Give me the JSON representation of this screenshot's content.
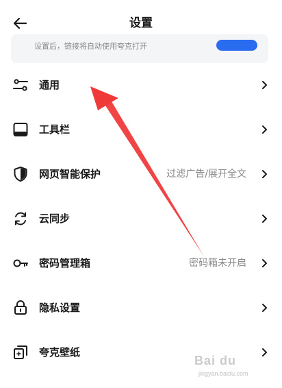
{
  "header": {
    "title": "设置"
  },
  "notice": {
    "text": "设置后，链接将自动使用夸克打开"
  },
  "settings": [
    {
      "label": "通用",
      "value": "",
      "icon": "sliders-icon"
    },
    {
      "label": "工具栏",
      "value": "",
      "icon": "toolbar-icon"
    },
    {
      "label": "网页智能保护",
      "value": "过滤广告/展开全文",
      "icon": "shield-icon"
    },
    {
      "label": "云同步",
      "value": "",
      "icon": "sync-icon"
    },
    {
      "label": "密码管理箱",
      "value": "密码箱未开启",
      "icon": "key-icon"
    },
    {
      "label": "隐私设置",
      "value": "",
      "icon": "lock-icon"
    },
    {
      "label": "夸克壁纸",
      "value": "",
      "icon": "wallpaper-icon"
    }
  ],
  "watermark": {
    "brand": "Bai du",
    "domain": "jingyan.baidu.com"
  },
  "colors": {
    "accent": "#2a6cf0",
    "annotation_arrow": "#f03a3a"
  }
}
